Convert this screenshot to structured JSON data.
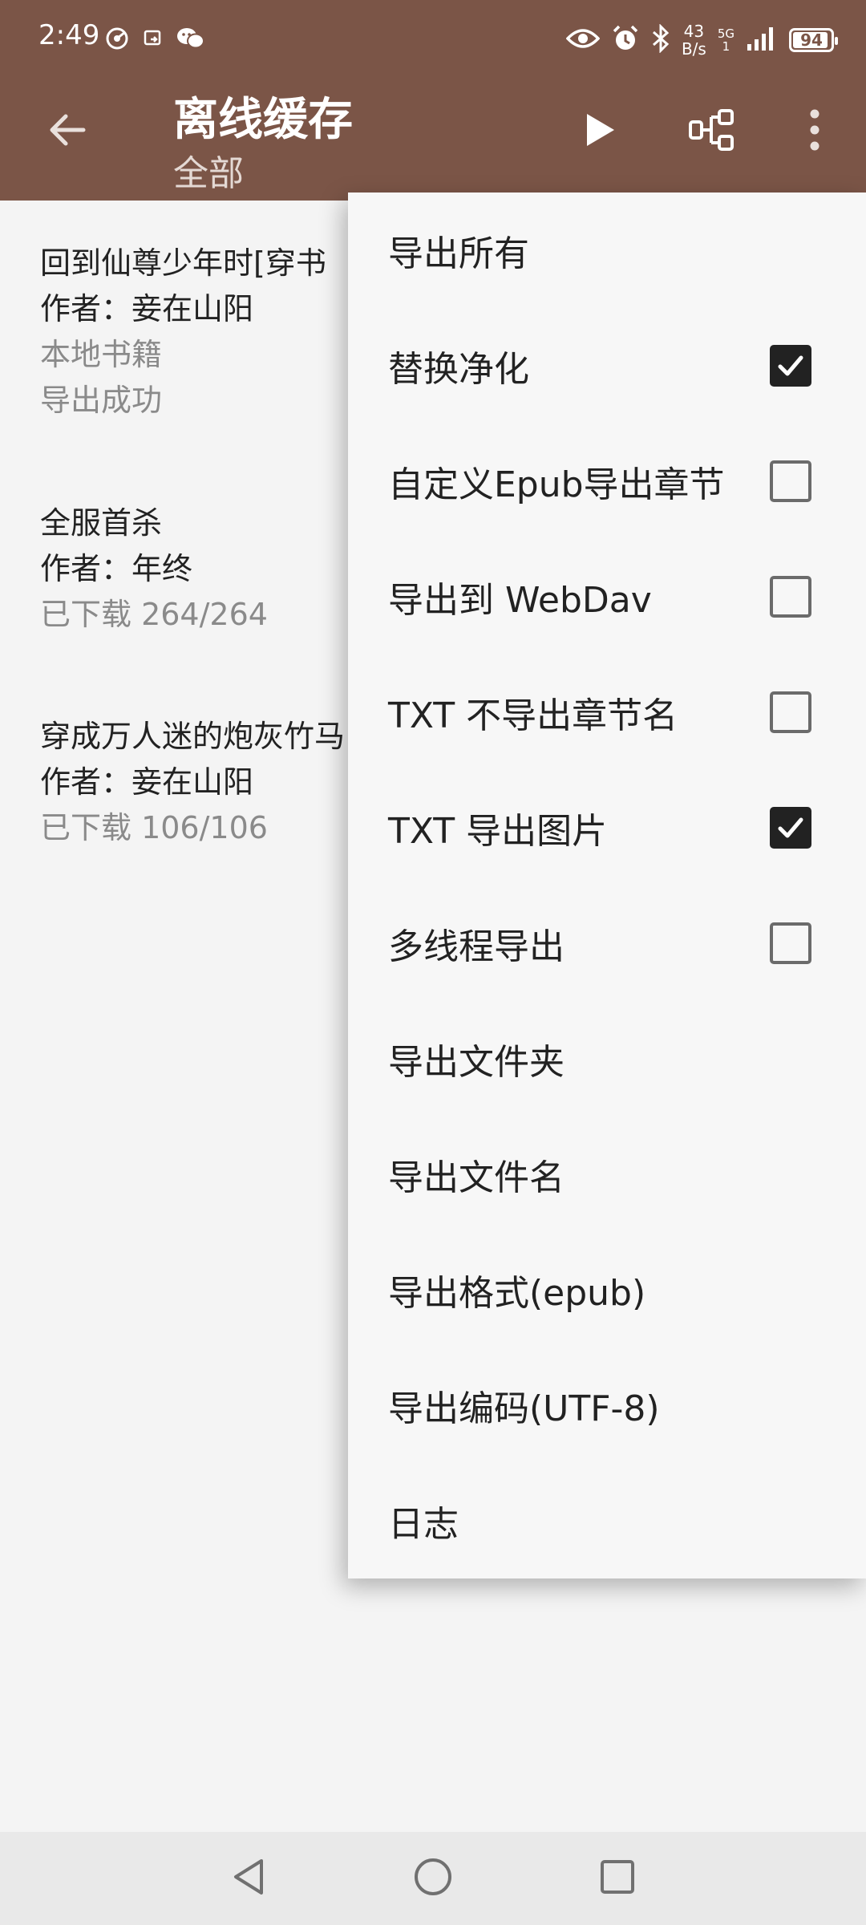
{
  "status_bar": {
    "time": "2:49",
    "net_speed_value": "43",
    "net_speed_unit": "B/s",
    "net_type": "5G",
    "net_sim": "1",
    "battery_level": 94,
    "battery_label": "94",
    "left_icons": [
      "hotspot-icon",
      "cast-icon",
      "wechat-icon"
    ],
    "right_icons": [
      "eye-icon",
      "alarm-icon",
      "bluetooth-icon",
      "signal-icon",
      "battery-icon"
    ]
  },
  "toolbar": {
    "title": "离线缓存",
    "subtitle": "全部",
    "icons": [
      "back-arrow-icon",
      "play-icon",
      "group-icon",
      "more-vert-icon"
    ]
  },
  "books": [
    {
      "title": "回到仙尊少年时[穿书",
      "author": "作者：妾在山阳",
      "meta": [
        "本地书籍",
        "导出成功"
      ]
    },
    {
      "title": "全服首杀",
      "author": "作者：年终",
      "meta": [
        "已下载 264/264"
      ]
    },
    {
      "title": "穿成万人迷的炮灰竹马",
      "author": "作者：妾在山阳",
      "meta": [
        "已下载 106/106"
      ]
    }
  ],
  "menu": {
    "items": [
      {
        "label": "导出所有",
        "has_checkbox": false,
        "checked": false
      },
      {
        "label": "替换净化",
        "has_checkbox": true,
        "checked": true
      },
      {
        "label": "自定义Epub导出章节",
        "has_checkbox": true,
        "checked": false
      },
      {
        "label": "导出到 WebDav",
        "has_checkbox": true,
        "checked": false
      },
      {
        "label": "TXT 不导出章节名",
        "has_checkbox": true,
        "checked": false
      },
      {
        "label": "TXT 导出图片",
        "has_checkbox": true,
        "checked": true
      },
      {
        "label": "多线程导出",
        "has_checkbox": true,
        "checked": false
      },
      {
        "label": "导出文件夹",
        "has_checkbox": false,
        "checked": false
      },
      {
        "label": "导出文件名",
        "has_checkbox": false,
        "checked": false
      },
      {
        "label": "导出格式(epub)",
        "has_checkbox": false,
        "checked": false
      },
      {
        "label": "导出编码(UTF-8)",
        "has_checkbox": false,
        "checked": false
      },
      {
        "label": "日志",
        "has_checkbox": false,
        "checked": false
      }
    ]
  },
  "nav_bar": {
    "icons": [
      "nav-back-icon",
      "nav-home-icon",
      "nav-recent-icon"
    ]
  },
  "colors": {
    "header": "#7b5547",
    "background": "#f4f4f4",
    "menu_background": "#f7f7f7",
    "checkbox_checked": "#222222",
    "checkbox_border": "#6b6b6b",
    "text_primary": "#222222",
    "text_secondary": "#8a8a8a"
  }
}
